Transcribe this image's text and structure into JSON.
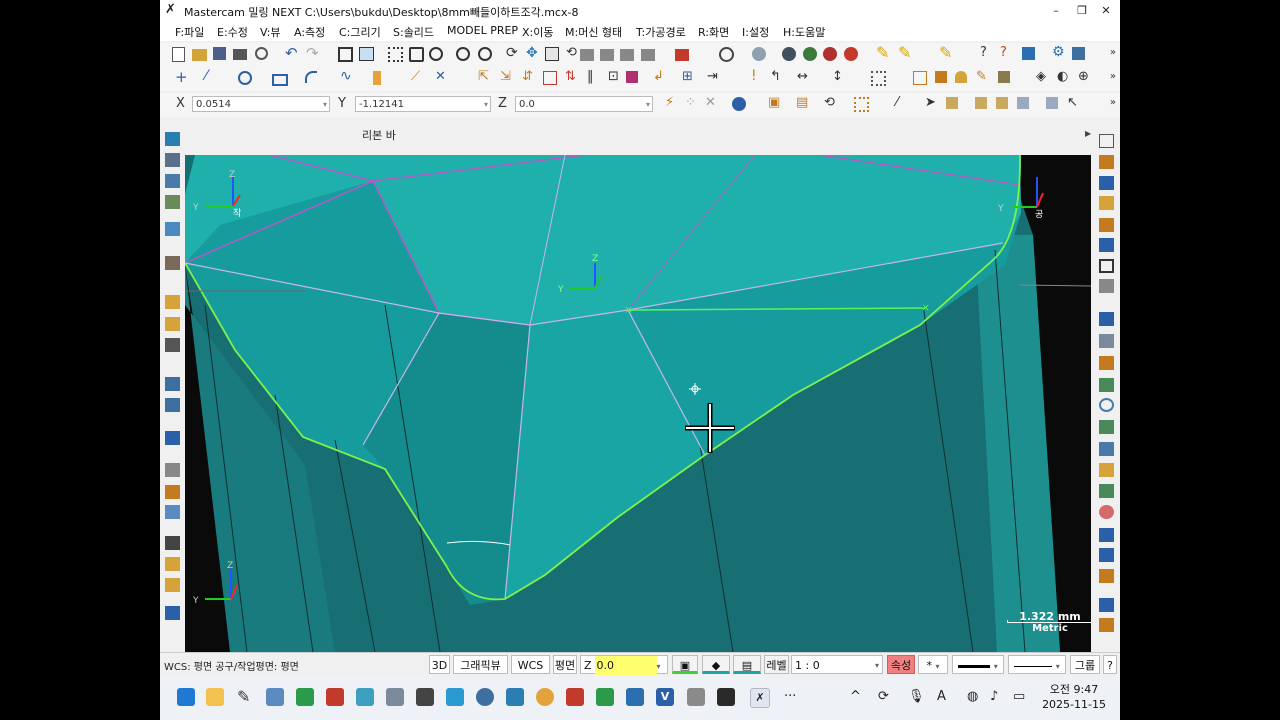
{
  "window": {
    "title": "Mastercam 밀링 NEXT  C:\\Users\\bukdu\\Desktop\\8mm빼들이하트조각.mcx-8",
    "min_glyph": "–",
    "max_glyph": "❐",
    "close_glyph": "✕"
  },
  "menu": [
    "F:파일",
    "E:수정",
    "V:뷰",
    "A:측정",
    "C:그리기",
    "S:솔리드",
    "MODEL PREP",
    "X:이동",
    "M:머신 형태",
    "T:가공경로",
    "R:화면",
    "I:설정",
    "H:도움말"
  ],
  "coords": {
    "x_label": "X",
    "x_value": "0.0514",
    "y_label": "Y",
    "y_value": "-1.12141",
    "z_label": "Z",
    "z_value": "0.0"
  },
  "ribbon_label": "리본 바",
  "viewport": {
    "background": "#0a0a0a",
    "surface_color": "#1aa5a5",
    "axis_labels": {
      "tl_y": "Y",
      "tl_z": "Z",
      "tl_plane": "작",
      "tr_y": "Y",
      "tr_plane": "공",
      "c_y": "Y",
      "c_z": "Z",
      "bl_y": "Y",
      "bl_z": "Z"
    },
    "scale_value": "1.322 mm",
    "scale_unit": "Metric"
  },
  "status": {
    "wcs_text": "WCS: 평면  공구/작업평면: 평면",
    "btn_3d": "3D",
    "btn_gview": "그래픽뷰",
    "btn_wcs": "WCS",
    "btn_plane": "평면",
    "z_label": "Z",
    "z_value": "0.0",
    "level_label": "레벨",
    "level_value": "1 : 0",
    "attr_label": "속성",
    "star": "*",
    "group_label": "그룹",
    "help": "?"
  },
  "taskbar": {
    "time": "오전 9:47",
    "date": "2025-11-15",
    "more": "···",
    "caret": "^",
    "lang": "A"
  }
}
